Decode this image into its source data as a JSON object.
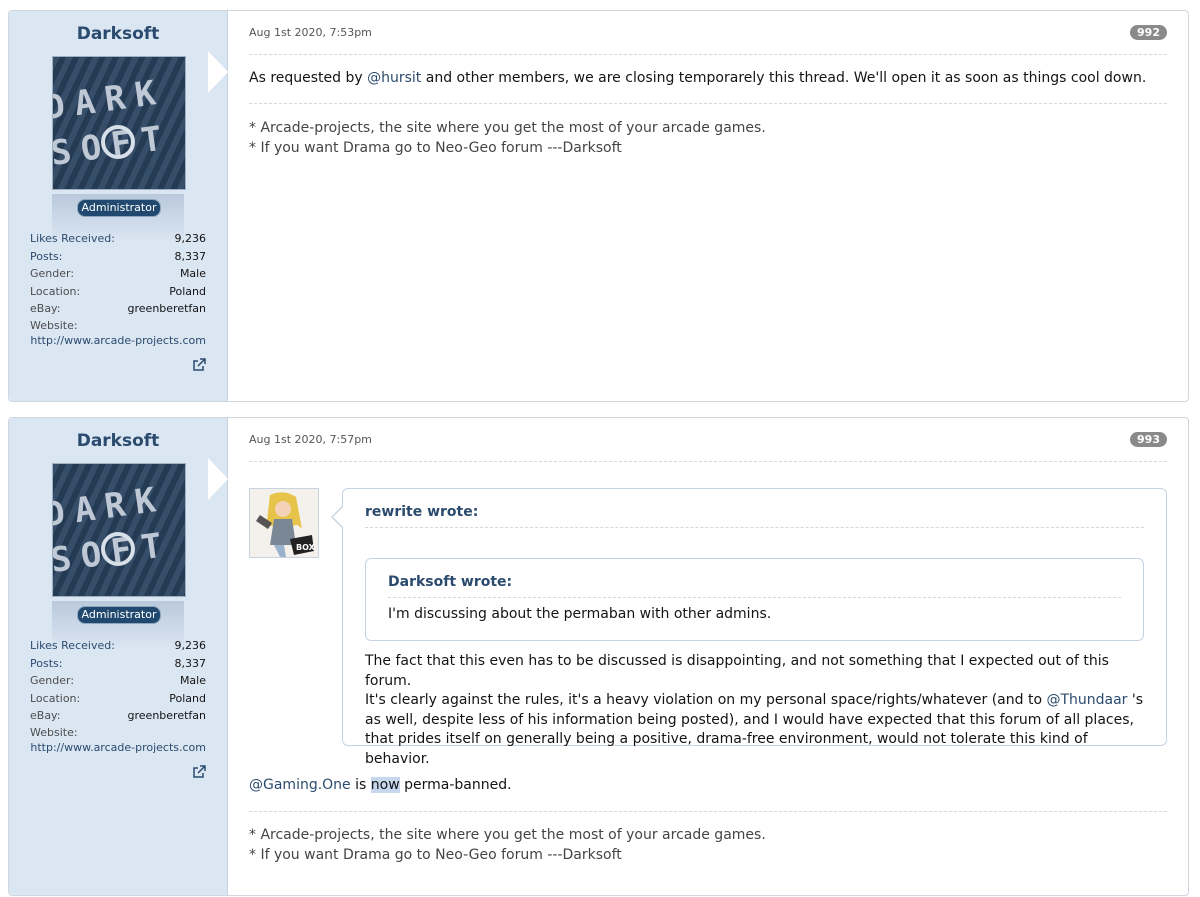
{
  "posts": [
    {
      "username": "Darksoft",
      "avatar_text": "DARK SOFT",
      "badge": "Administrator",
      "stats": [
        {
          "label": "Likes Received:",
          "value": "9,236"
        },
        {
          "label": "Posts:",
          "value": "8,337"
        },
        {
          "label": "Gender:",
          "value": "Male"
        },
        {
          "label": "Location:",
          "value": "Poland"
        },
        {
          "label": "eBay:",
          "value": "greenberetfan"
        }
      ],
      "website_label": "Website:",
      "website_url": "http://www.arcade-projects.com",
      "date": "Aug 1st 2020, 7:53pm",
      "number": "992",
      "body": {
        "pre": "As requested by ",
        "mention": "@hursit",
        "post": " and other members, we are closing temporarely this thread. We'll open it as soon as things cool down."
      },
      "signature": [
        "* Arcade-projects, the site where you get the most of your arcade games.",
        "* If you want Drama go to Neo-Geo forum ---Darksoft"
      ]
    },
    {
      "username": "Darksoft",
      "avatar_text": "DARK SOFT",
      "badge": "Administrator",
      "stats": [
        {
          "label": "Likes Received:",
          "value": "9,236"
        },
        {
          "label": "Posts:",
          "value": "8,337"
        },
        {
          "label": "Gender:",
          "value": "Male"
        },
        {
          "label": "Location:",
          "value": "Poland"
        },
        {
          "label": "eBay:",
          "value": "greenberetfan"
        }
      ],
      "website_label": "Website:",
      "website_url": "http://www.arcade-projects.com",
      "date": "Aug 1st 2020, 7:57pm",
      "number": "993",
      "quote": {
        "author": "rewrite wrote:",
        "inner_author": "Darksoft wrote:",
        "inner_text": "I'm discussing about the permaban with other admins.",
        "line1": "The fact that this even has to be discussed is disappointing, and not something that I expected out of this forum.",
        "line2_pre": "It's clearly against the rules, it's a heavy violation on my personal space/rights/whatever (and to ",
        "line2_mention": "@Thundaar",
        "line2_post": " 's as well, despite less of his information being posted), and I would have expected that this forum of all places, that prides itself on generally being a positive, drama-free environment, would not tolerate this kind of behavior."
      },
      "body": {
        "mention": "@Gaming.One",
        "is": " is ",
        "highlight": "now",
        "post": " perma-banned."
      },
      "signature": [
        "* Arcade-projects, the site where you get the most of your arcade games.",
        "* If you want Drama go to Neo-Geo forum ---Darksoft"
      ]
    }
  ]
}
